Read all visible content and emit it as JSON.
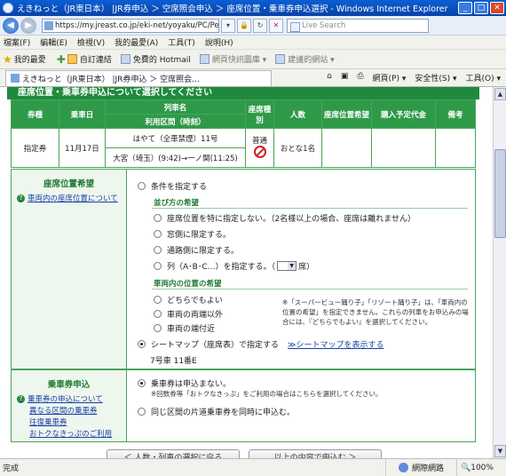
{
  "window": {
    "title": "えきねっと（JR東日本） |JR券申込 ＞ 空席照会申込 ＞ 座席位置・乗車券申込選択 - Windows Internet Explorer"
  },
  "address": {
    "url": "https://my.jreast.co.jp/eki-net/yoyaku/PC/Personal/JR",
    "search_placeholder": "Live Search"
  },
  "menu": [
    "檔案(F)",
    "編輯(E)",
    "檢視(V)",
    "我的最愛(A)",
    "工具(T)",
    "說明(H)"
  ],
  "favorites": {
    "label": "我的最愛",
    "items": [
      "自訂連結",
      "免費的 Hotmail",
      "網頁快訊圖庫 ▾",
      "建議的網站 ▾"
    ]
  },
  "tab": {
    "title": "えきねっと（JR東日本） |JR券申込 ＞ 空席照会..."
  },
  "commands": [
    "網頁(P) ▾",
    "安全性(S) ▾",
    "工具(O) ▾"
  ],
  "section_title": "座席位置・乗車券申込について選択してください",
  "ticket_table": {
    "headers": {
      "type": "券種",
      "date": "乗車日",
      "train": "列車名",
      "section": "利用区間（時刻）",
      "car": "座席種別",
      "people": "人数",
      "seat_pos": "座席位置希望",
      "price": "購入予定代金",
      "note": "備考"
    },
    "row": {
      "type": "指定券",
      "date": "11月17日",
      "train": "はやて（全車禁煙）11号",
      "section": "大宮（埼玉）(9:42)→一ノ関(11:25)",
      "car": "普通",
      "people": "おとな1名",
      "seat_pos": "",
      "price": "",
      "note": ""
    }
  },
  "seat_pref": {
    "title": "座席位置希望",
    "help_link": "車両内の座席位置について",
    "opt_specify": "条件を指定する",
    "group_order": "並び方の希望",
    "opt_none": "座席位置を特に指定しない。（2名様以上の場合、座席は離れません）",
    "opt_window": "窓側に限定する。",
    "opt_aisle": "通路側に限定する。",
    "opt_row_a": "列（A･B･C…）を指定する。（",
    "opt_row_b": "席）",
    "group_position": "車両内の位置の希望",
    "opt_any": "どちらでもよい",
    "opt_ends": "車両の両端以外",
    "opt_near_end": "車両の端付近",
    "note": "※「スーパービュー踊り子」「リゾート踊り子」は、「車両内の位置の希望」を指定できません。これらの列車をお申込みの場合には、『どちらでもよい』を選択してください。",
    "opt_seatmap": "シートマップ（座席表）で指定する",
    "seatmap_link": "≫シートマップを表示する",
    "selected_seat": "7号車 11番E"
  },
  "ticket_apply": {
    "title": "乗車券申込",
    "help_link": "乗車券の申込について",
    "sub_links": [
      "異なる区間の乗車券",
      "往復乗車券",
      "おトクなきっぷのご利用"
    ],
    "opt_no": "乗車券は申込まない。",
    "opt_no_note": "※回数券等「おトクなきっぷ」をご利用の場合はこちらを選択してください。",
    "opt_same": "同じ区間の片道乗車券を同時に申込む。"
  },
  "buttons": {
    "back": "＜ 人数・列車の選択に戻る",
    "next": "以上の内容で申込む ＞"
  },
  "status": {
    "left": "完成",
    "zone": "網際網路",
    "zoom": "100%"
  }
}
